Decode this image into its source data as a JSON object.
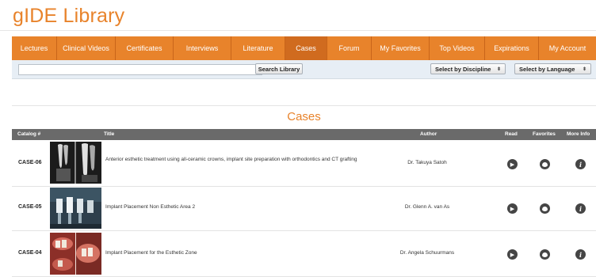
{
  "app": {
    "title": "gIDE Library"
  },
  "nav": {
    "items": [
      {
        "label": "Lectures"
      },
      {
        "label": "Clinical Videos"
      },
      {
        "label": "Certificates"
      },
      {
        "label": "Interviews"
      },
      {
        "label": "Literature"
      },
      {
        "label": "Cases",
        "active": true
      },
      {
        "label": "Forum"
      },
      {
        "label": "My Favorites"
      },
      {
        "label": "Top Videos"
      },
      {
        "label": "Expirations"
      },
      {
        "label": "My Account"
      }
    ]
  },
  "search": {
    "placeholder": "",
    "value": "",
    "button_label": "Search Library",
    "discipline_label": "Select by Discipline",
    "language_label": "Select by Language"
  },
  "section": {
    "title": "Cases"
  },
  "table": {
    "headers": {
      "catalog": "Catalog #",
      "title": "Title",
      "author": "Author",
      "read": "Read",
      "favorites": "Favorites",
      "more_info": "More Info"
    },
    "rows": [
      {
        "catalog": "CASE-06",
        "title": "Anterior esthetic treatment using all-ceramic crowns, implant site preparation with orthodontics and CT grafting",
        "author": "Dr. Takuya Satoh",
        "thumb": "xray-pair"
      },
      {
        "catalog": "CASE-05",
        "title": "Implant Placement Non Esthetic Area 2",
        "author": "Dr. Glenn A. van As",
        "thumb": "xray-implants"
      },
      {
        "catalog": "CASE-04",
        "title": "Implant Placement for the Esthetic Zone",
        "author": "Dr. Angela Schuurmans",
        "thumb": "clinical-photos"
      }
    ]
  },
  "colors": {
    "accent": "#e8832b",
    "nav_active": "#d06b1f",
    "header_gray": "#6a6a6a",
    "search_bg": "#e7eef5",
    "icon_dark": "#454545"
  },
  "icons": {
    "read": "play-circle-icon",
    "favorite": "heart-circle-icon",
    "info": "info-circle-icon"
  }
}
